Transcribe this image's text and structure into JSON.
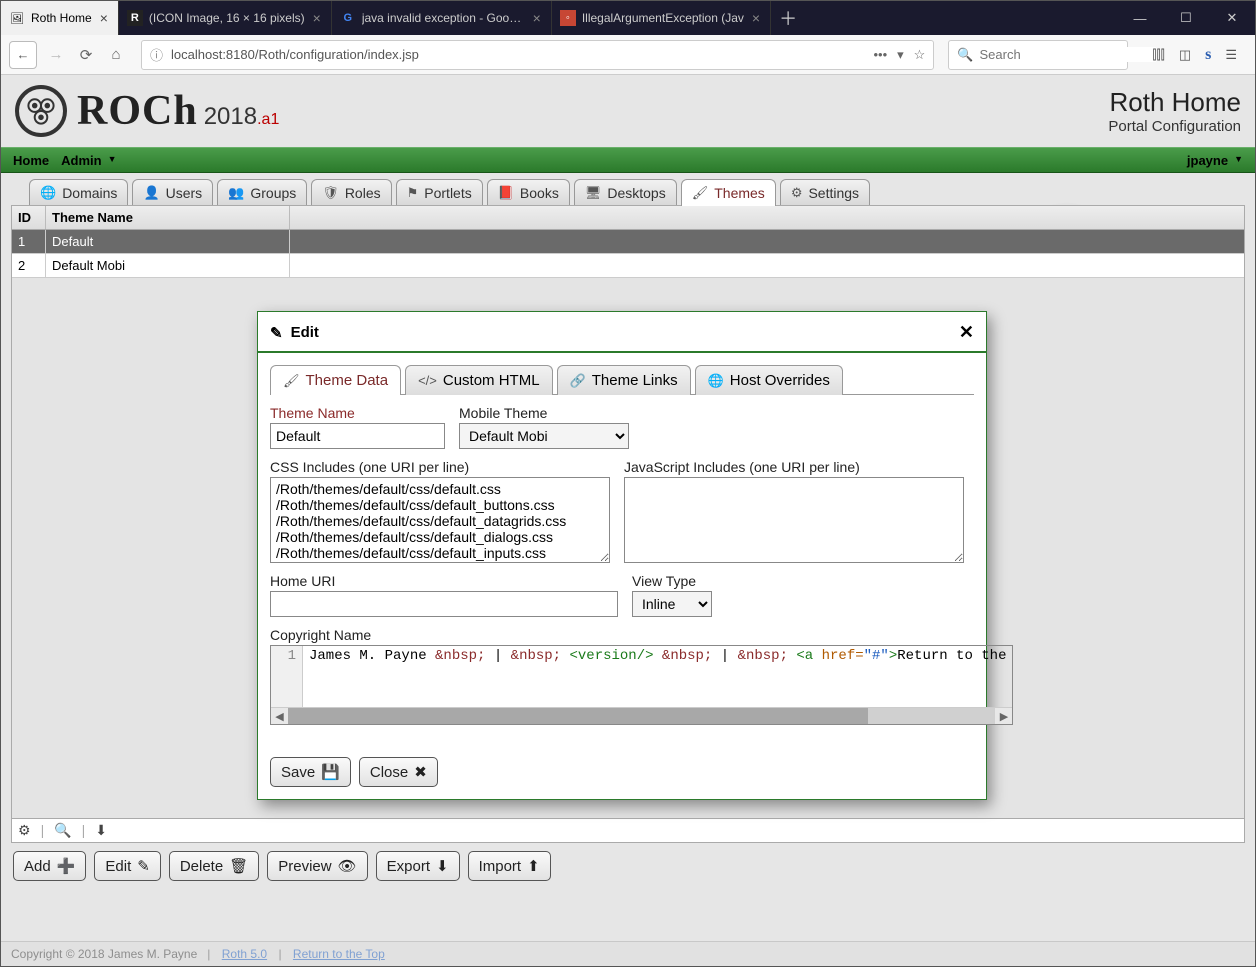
{
  "browser": {
    "tabs": [
      {
        "title": "Roth Home",
        "active": true
      },
      {
        "title": "(ICON Image, 16 × 16 pixels)",
        "active": false
      },
      {
        "title": "java invalid exception - Google",
        "active": false
      },
      {
        "title": "IllegalArgumentException (Jav",
        "active": false
      }
    ],
    "url": "localhost:8180/Roth/configuration/index.jsp",
    "search_placeholder": "Search"
  },
  "header": {
    "logo_text": "ROCh",
    "year": "2018",
    "suffix": ".a1",
    "title": "Roth Home",
    "subtitle": "Portal Configuration"
  },
  "menubar": {
    "home": "Home",
    "admin": "Admin",
    "user": "jpayne"
  },
  "main_tabs": [
    {
      "key": "domains",
      "label": "Domains",
      "icon": "🌐"
    },
    {
      "key": "users",
      "label": "Users",
      "icon": "👤"
    },
    {
      "key": "groups",
      "label": "Groups",
      "icon": "👥"
    },
    {
      "key": "roles",
      "label": "Roles",
      "icon": "🛡"
    },
    {
      "key": "portlets",
      "label": "Portlets",
      "icon": "⚑"
    },
    {
      "key": "books",
      "label": "Books",
      "icon": "📕"
    },
    {
      "key": "desktops",
      "label": "Desktops",
      "icon": "🖥"
    },
    {
      "key": "themes",
      "label": "Themes",
      "icon": "🖌",
      "active": true
    },
    {
      "key": "settings",
      "label": "Settings",
      "icon": "⚙"
    }
  ],
  "grid": {
    "headers": {
      "id": "ID",
      "name": "Theme Name"
    },
    "rows": [
      {
        "id": "1",
        "name": "Default",
        "selected": true
      },
      {
        "id": "2",
        "name": "Default Mobi",
        "selected": false
      }
    ]
  },
  "actions": {
    "add": "Add",
    "edit": "Edit",
    "delete": "Delete",
    "preview": "Preview",
    "export": "Export",
    "import": "Import"
  },
  "footer": {
    "copyright": "Copyright © 2018 James M. Payne",
    "link1": "Roth 5.0",
    "link2": "Return to the Top"
  },
  "dialog": {
    "title": "Edit",
    "tabs": [
      {
        "label": "Theme Data",
        "icon": "🖌",
        "active": true
      },
      {
        "label": "Custom HTML",
        "icon": "</>"
      },
      {
        "label": "Theme Links",
        "icon": "🔗"
      },
      {
        "label": "Host Overrides",
        "icon": "🌐"
      }
    ],
    "labels": {
      "theme_name": "Theme Name",
      "mobile_theme": "Mobile Theme",
      "css_includes": "CSS Includes (one URI per line)",
      "js_includes": "JavaScript Includes (one URI per line)",
      "home_uri": "Home URI",
      "view_type": "View Type",
      "copyright_name": "Copyright Name"
    },
    "values": {
      "theme_name": "Default",
      "mobile_theme": "Default Mobi",
      "css_includes": "/Roth/themes/default/css/default.css\n/Roth/themes/default/css/default_buttons.css\n/Roth/themes/default/css/default_datagrids.css\n/Roth/themes/default/css/default_dialogs.css\n/Roth/themes/default/css/default_inputs.css",
      "js_includes": "",
      "home_uri": "",
      "view_type": "Inline",
      "copyright_tokens": {
        "t1": "James M. Payne ",
        "e1": "&nbsp;",
        "t2": " | ",
        "e2": "&nbsp;",
        "t3": " ",
        "tag1": "<version/>",
        "t4": " ",
        "e3": "&nbsp;",
        "t5": " | ",
        "e4": "&nbsp;",
        "t6": " ",
        "tag2a": "<a ",
        "attr": "href=",
        "str": "\"#\"",
        "tag2b": ">",
        "t7": "Return to the"
      },
      "gutter": "1"
    },
    "buttons": {
      "save": "Save",
      "close": "Close"
    }
  }
}
